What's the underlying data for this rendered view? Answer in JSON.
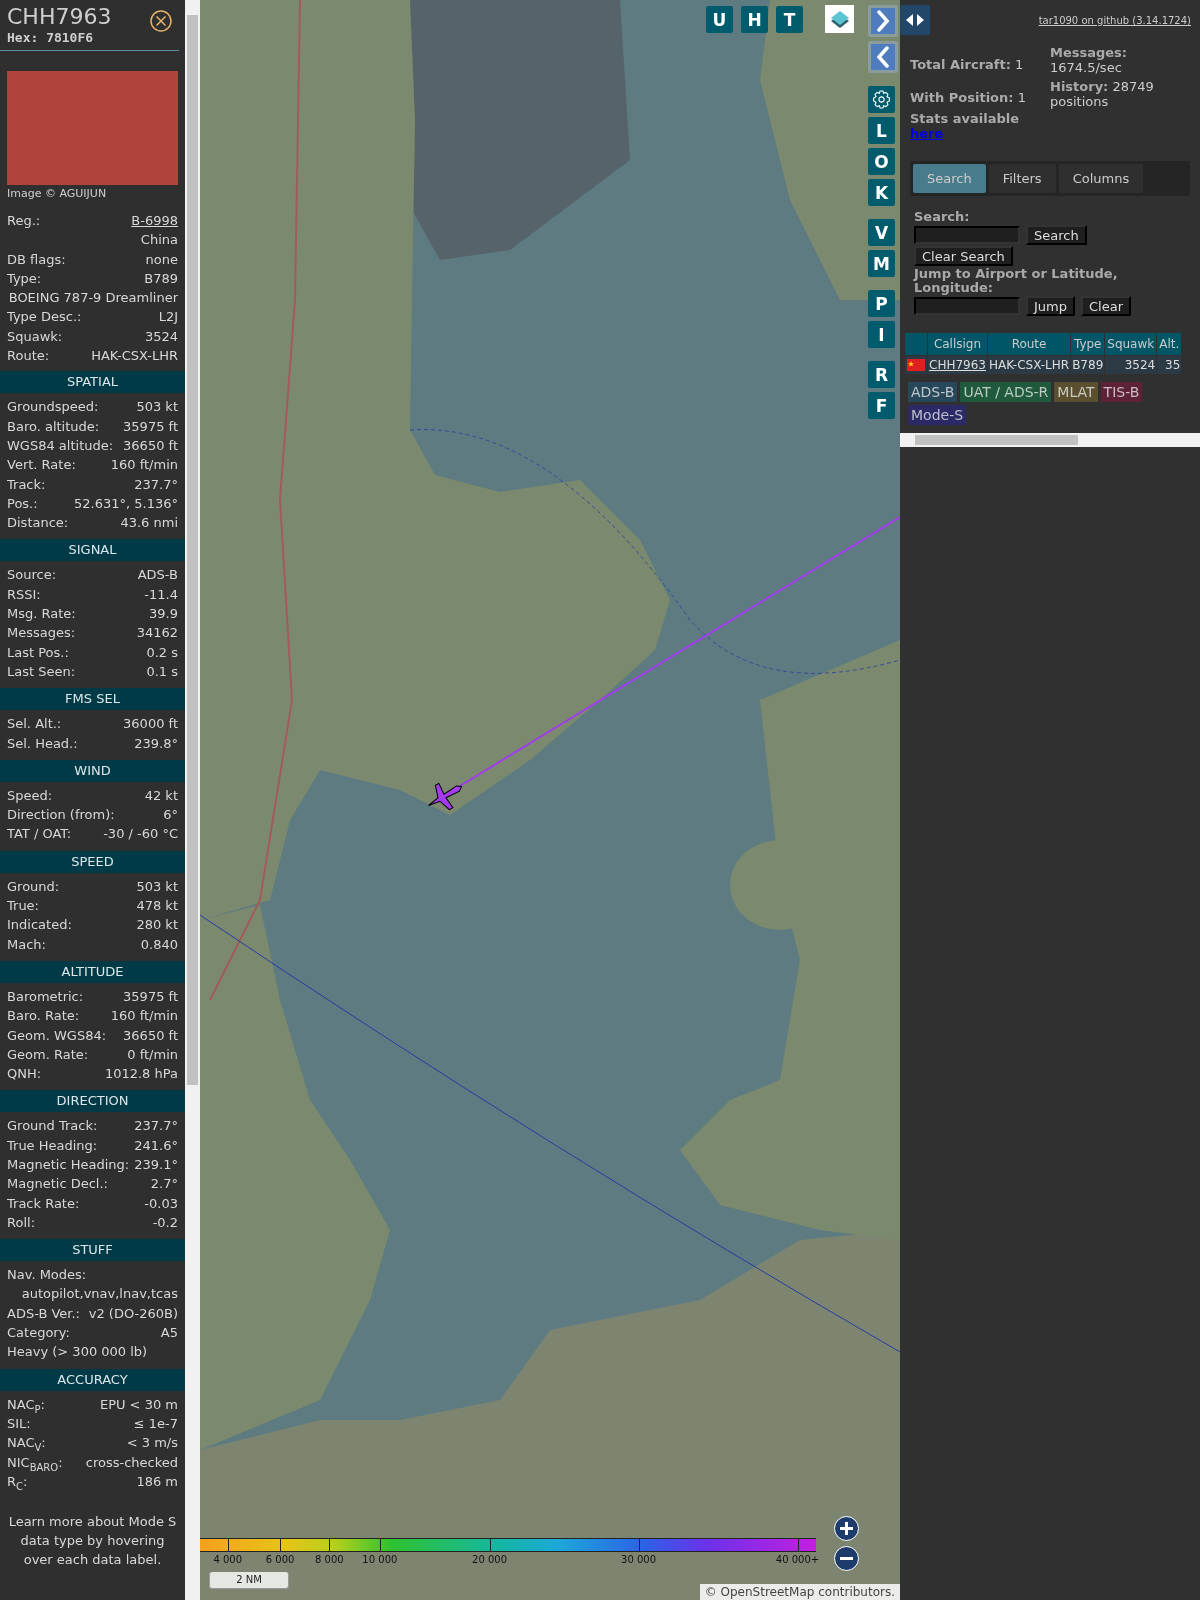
{
  "detail": {
    "callsign": "CHH7963",
    "hex": "Hex: 7810F6",
    "photo_credit": "Image © AGUIJUN",
    "rows": [
      {
        "kind": "link",
        "label": "Reg.:",
        "value": "B-6998"
      },
      {
        "kind": "value",
        "value": "China"
      },
      {
        "kind": "pair",
        "label": "DB flags:",
        "value": "none"
      },
      {
        "kind": "pair",
        "label": "Type:",
        "value": "B789"
      },
      {
        "kind": "value",
        "value": "BOEING 787-9 Dreamliner"
      },
      {
        "kind": "pair",
        "label": "Type Desc.:",
        "value": "L2J"
      },
      {
        "kind": "pair",
        "label": "Squawk:",
        "value": "3524"
      },
      {
        "kind": "pair",
        "label": "Route:",
        "value": "HAK-CSX-LHR"
      }
    ],
    "sections": [
      {
        "title": "SPATIAL",
        "rows": [
          {
            "kind": "pair",
            "label": "Groundspeed:",
            "value": "503 kt"
          },
          {
            "kind": "pair",
            "label": "Baro. altitude:",
            "value": "35975 ft"
          },
          {
            "kind": "pair",
            "label": "WGS84 altitude:",
            "value": "36650 ft"
          },
          {
            "kind": "pair",
            "label": "Vert. Rate:",
            "value": "160 ft/min"
          },
          {
            "kind": "pair",
            "label": "Track:",
            "value": "237.7°"
          },
          {
            "kind": "pair",
            "label": "Pos.:",
            "value": "52.631°, 5.136°"
          },
          {
            "kind": "pair",
            "label": "Distance:",
            "value": "43.6 nmi"
          }
        ]
      },
      {
        "title": "SIGNAL",
        "rows": [
          {
            "kind": "pair",
            "label": "Source:",
            "value": "ADS-B"
          },
          {
            "kind": "pair",
            "label": "RSSI:",
            "value": "-11.4"
          },
          {
            "kind": "pair",
            "label": "Msg. Rate:",
            "value": "39.9"
          },
          {
            "kind": "pair",
            "label": "Messages:",
            "value": "34162"
          },
          {
            "kind": "pair",
            "label": "Last Pos.:",
            "value": "0.2 s"
          },
          {
            "kind": "pair",
            "label": "Last Seen:",
            "value": "0.1 s"
          }
        ]
      },
      {
        "title": "FMS SEL",
        "rows": [
          {
            "kind": "pair",
            "label": "Sel. Alt.:",
            "value": "36000 ft"
          },
          {
            "kind": "pair",
            "label": "Sel. Head.:",
            "value": "239.8°"
          }
        ]
      },
      {
        "title": "WIND",
        "rows": [
          {
            "kind": "pair",
            "label": "Speed:",
            "value": "42 kt"
          },
          {
            "kind": "pair",
            "label": "Direction (from):",
            "value": "6°"
          },
          {
            "kind": "pair",
            "label": "TAT / OAT:",
            "value": "-30 / -60 °C"
          }
        ]
      },
      {
        "title": "SPEED",
        "rows": [
          {
            "kind": "pair",
            "label": "Ground:",
            "value": "503 kt"
          },
          {
            "kind": "pair",
            "label": "True:",
            "value": "478 kt"
          },
          {
            "kind": "pair",
            "label": "Indicated:",
            "value": "280 kt"
          },
          {
            "kind": "pair",
            "label": "Mach:",
            "value": "0.840"
          }
        ]
      },
      {
        "title": "ALTITUDE",
        "rows": [
          {
            "kind": "pair",
            "label": "Barometric:",
            "value": "35975 ft"
          },
          {
            "kind": "pair",
            "label": "Baro. Rate:",
            "value": "160 ft/min"
          },
          {
            "kind": "pair",
            "label": "Geom. WGS84:",
            "value": "36650 ft"
          },
          {
            "kind": "pair",
            "label": "Geom. Rate:",
            "value": "0 ft/min"
          },
          {
            "kind": "pair",
            "label": "QNH:",
            "value": "1012.8 hPa"
          }
        ]
      },
      {
        "title": "DIRECTION",
        "rows": [
          {
            "kind": "pair",
            "label": "Ground Track:",
            "value": "237.7°"
          },
          {
            "kind": "pair",
            "label": "True Heading:",
            "value": "241.6°"
          },
          {
            "kind": "pair",
            "label": "Magnetic Heading:",
            "value": "239.1°"
          },
          {
            "kind": "pair",
            "label": "Magnetic Decl.:",
            "value": "2.7°"
          },
          {
            "kind": "pair",
            "label": "Track Rate:",
            "value": "-0.03"
          },
          {
            "kind": "pair",
            "label": "Roll:",
            "value": "-0.2"
          }
        ]
      },
      {
        "title": "STUFF",
        "rows": [
          {
            "kind": "label",
            "label": "Nav. Modes:"
          },
          {
            "kind": "value",
            "value": "autopilot,vnav,lnav,tcas"
          },
          {
            "kind": "pair",
            "label": "ADS-B Ver.:",
            "value": "v2 (DO-260B)"
          },
          {
            "kind": "pair",
            "label": "Category:",
            "value": "A5"
          },
          {
            "kind": "label",
            "label": "Heavy (> 300 000 lb)"
          }
        ]
      },
      {
        "title": "ACCURACY",
        "rows": [
          {
            "kind": "pair",
            "label": "NAC$_{P}$:",
            "value": "EPU < 30 m"
          },
          {
            "kind": "pair",
            "label": "SIL:",
            "value": "≤ 1e-7"
          },
          {
            "kind": "pair",
            "label": "NAC$_{V}$:",
            "value": "< 3 m/s"
          },
          {
            "kind": "pair",
            "label": "NIC$_{BARO}$:",
            "value": "cross-checked"
          },
          {
            "kind": "pair",
            "label": "R$_{C}$:",
            "value": "186 m"
          }
        ]
      }
    ],
    "footnote": "Learn more about Mode S data type by hovering over each data label."
  },
  "map": {
    "top_buttons": [
      "U",
      "H",
      "T"
    ],
    "side_groups": [
      [
        {
          "kind": "next"
        },
        {
          "kind": "prev"
        }
      ],
      [
        {
          "kind": "settings"
        },
        {
          "kind": "letter",
          "label": "L"
        },
        {
          "kind": "letter",
          "label": "O"
        },
        {
          "kind": "letter",
          "label": "K"
        }
      ],
      [
        {
          "kind": "letter",
          "label": "V"
        },
        {
          "kind": "letter",
          "label": "M"
        }
      ],
      [
        {
          "kind": "letter",
          "label": "P"
        },
        {
          "kind": "letter",
          "label": "I"
        }
      ],
      [
        {
          "kind": "letter",
          "label": "R"
        },
        {
          "kind": "letter",
          "label": "F"
        }
      ]
    ],
    "legend": [
      "4 000",
      "6 000",
      "8 000",
      "10 000",
      "20 000",
      "30 000",
      "40 000+"
    ],
    "scale": "2 NM",
    "attribution": {
      "prefix": "©",
      "link": "OpenStreetMap",
      "suffix": "contributors."
    }
  },
  "panel": {
    "version_link": "tar1090 on github (3.14.1724)",
    "stats_left": [
      {
        "label": "Total Aircraft:",
        "value": "1"
      },
      {
        "label": "With Position:",
        "value": "1"
      }
    ],
    "stats_note": {
      "text": "Stats available",
      "link": "here"
    },
    "stats_right": [
      {
        "label": "Messages:",
        "value": "1674.5/sec"
      },
      {
        "label": "History:",
        "value": "28749 positions"
      }
    ],
    "tabs": [
      {
        "label": "Search",
        "selected": true
      },
      {
        "label": "Filters",
        "selected": false
      },
      {
        "label": "Columns",
        "selected": false
      }
    ],
    "search": {
      "label": "Search:",
      "button": "Search",
      "clear": "Clear Search"
    },
    "jump": {
      "label": "Jump to Airport or Latitude, Longitude:",
      "button": "Jump",
      "clear": "Clear"
    },
    "table": {
      "columns": [
        "Callsign",
        "Route",
        "Type",
        "Squawk",
        "Alt."
      ],
      "rows": [
        {
          "cells": [
            "CHH7963",
            "HAK-CSX-LHR",
            "B789",
            "3524",
            "35"
          ]
        }
      ]
    },
    "sources": [
      {
        "label": "ADS-B",
        "color": "#27485a"
      },
      {
        "label": "UAT / ADS-R",
        "color": "#1f5a3c"
      },
      {
        "label": "MLAT",
        "color": "#5a5030"
      },
      {
        "label": "TIS-B",
        "color": "#5e2238"
      },
      {
        "label": "Mode-S",
        "color": "#2c2a66"
      }
    ]
  }
}
